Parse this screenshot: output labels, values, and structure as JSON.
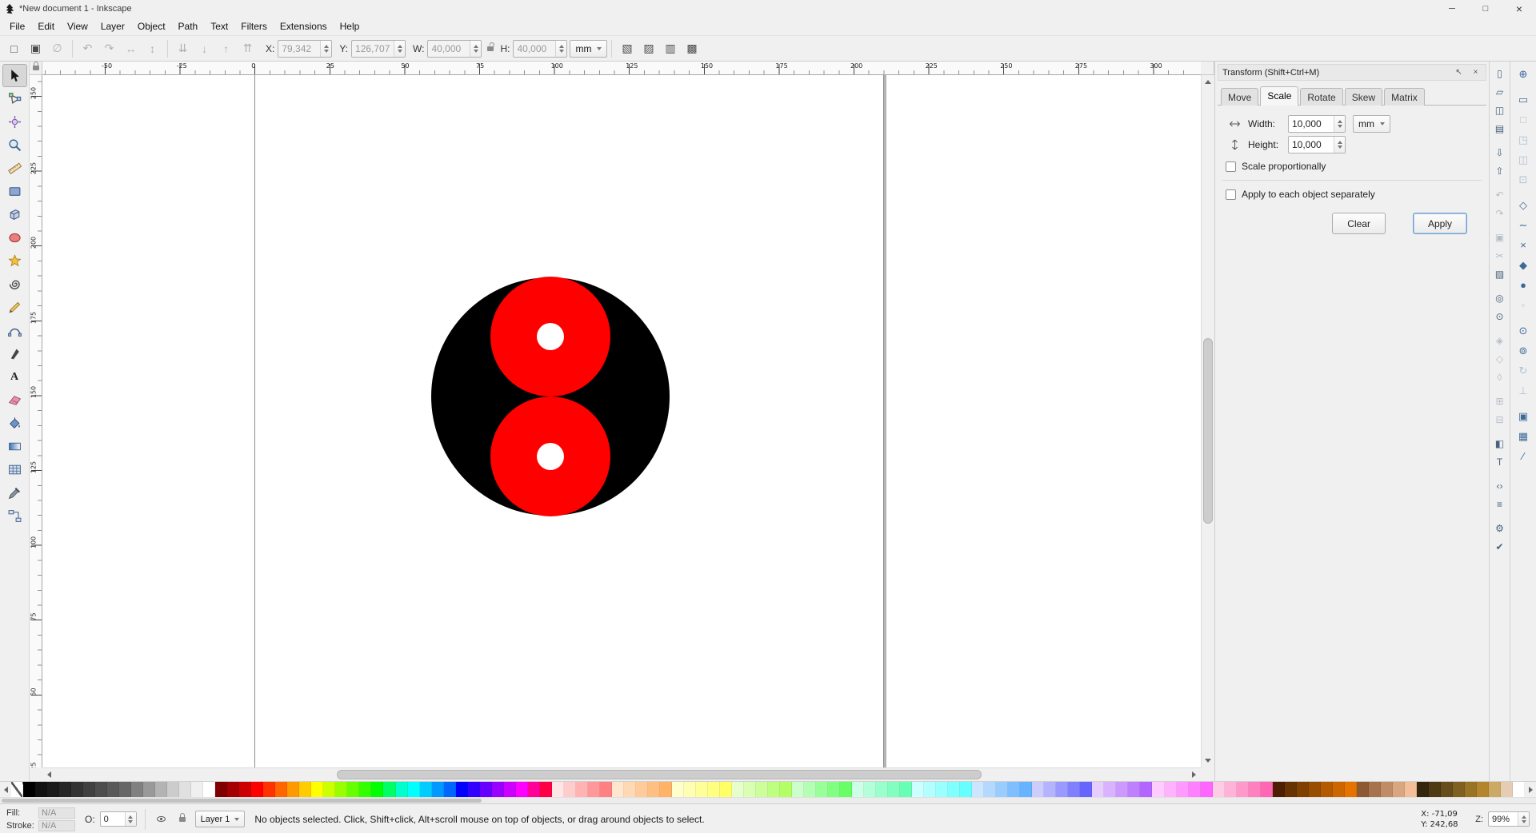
{
  "window": {
    "title": "*New document 1 - Inkscape",
    "minimize_glyph": "─",
    "maximize_glyph": "□",
    "close_glyph": "×"
  },
  "menu": {
    "items": [
      "File",
      "Edit",
      "View",
      "Layer",
      "Object",
      "Path",
      "Text",
      "Filters",
      "Extensions",
      "Help"
    ]
  },
  "toolbar": {
    "groups": [
      [
        {
          "name": "select-all-icon",
          "glyph": "□"
        },
        {
          "name": "select-all-layers-icon",
          "glyph": "▣"
        },
        {
          "name": "deselect-icon",
          "glyph": "∅",
          "disabled": true
        }
      ],
      [
        {
          "name": "rotate-ccw-icon",
          "glyph": "↶",
          "disabled": true
        },
        {
          "name": "rotate-cw-icon",
          "glyph": "↷",
          "disabled": true
        },
        {
          "name": "flip-horizontal-icon",
          "glyph": "↔",
          "disabled": true
        },
        {
          "name": "flip-vertical-icon",
          "glyph": "↕",
          "disabled": true
        }
      ],
      [
        {
          "name": "lower-to-bottom-icon",
          "glyph": "⇊",
          "disabled": true
        },
        {
          "name": "lower-icon",
          "glyph": "↓",
          "disabled": true
        },
        {
          "name": "raise-icon",
          "glyph": "↑",
          "disabled": true
        },
        {
          "name": "raise-to-top-icon",
          "glyph": "⇈",
          "disabled": true
        }
      ]
    ],
    "affect_group": [
      {
        "name": "move-gradients-toggle-icon",
        "glyph": "▧"
      },
      {
        "name": "move-patterns-toggle-icon",
        "glyph": "▨"
      },
      {
        "name": "transform-stroke-toggle-icon",
        "glyph": "▥"
      },
      {
        "name": "preserve-corners-toggle-icon",
        "glyph": "▩"
      }
    ],
    "fields": {
      "x_label": "X:",
      "x": "79,342",
      "y_label": "Y:",
      "y": "126,707",
      "w_label": "W:",
      "w": "40,000",
      "h_label": "H:",
      "h": "40,000",
      "unit": "mm"
    }
  },
  "toolbox": {
    "active_tool": "selector",
    "text_tool_glyph": "A",
    "tools": [
      "selector",
      "node-editor",
      "tweak",
      "zoom",
      "measure",
      "rectangle",
      "box-3d",
      "ellipse",
      "star",
      "spiral",
      "pencil",
      "bezier-pen",
      "calligraphy",
      "text",
      "eraser",
      "paint-bucket",
      "gradient",
      "mesh-gradient",
      "dropper",
      "connector"
    ]
  },
  "rulers": {
    "h_labels": [
      "-50",
      "-25",
      "0",
      "25",
      "50",
      "75",
      "100",
      "125",
      "150",
      "175",
      "200",
      "225",
      "250",
      "275",
      "300"
    ],
    "v_labels": [
      "250",
      "225",
      "200",
      "175",
      "150",
      "125",
      "100",
      "75",
      "50",
      "25"
    ]
  },
  "canvas": {
    "shapes": {
      "outer_fill": "#000000",
      "ring_fill": "#ff0000",
      "ring_stroke": "#c80000",
      "hole_fill": "#ffffff"
    }
  },
  "transform_panel": {
    "title": "Transform (Shift+Ctrl+M)",
    "float_glyph": "↖",
    "close_glyph": "×",
    "tabs": [
      "Move",
      "Scale",
      "Rotate",
      "Skew",
      "Matrix"
    ],
    "active_tab": "Scale",
    "width_label": "Width:",
    "width_value": "10,000",
    "height_label": "Height:",
    "height_value": "10,000",
    "unit": "mm",
    "scale_proportionally_label": "Scale proportionally",
    "apply_separately_label": "Apply to each object separately",
    "clear_label": "Clear",
    "apply_label": "Apply"
  },
  "right_commands": [
    {
      "name": "document-new-icon",
      "glyph": "▯"
    },
    {
      "name": "document-open-icon",
      "glyph": "▱"
    },
    {
      "name": "document-save-icon",
      "glyph": "◫"
    },
    {
      "name": "document-print-icon",
      "glyph": "▤"
    },
    {
      "gap": true
    },
    {
      "name": "import-icon",
      "glyph": "⇩"
    },
    {
      "name": "export-icon",
      "glyph": "⇧"
    },
    {
      "gap": true
    },
    {
      "name": "undo-icon",
      "glyph": "↶",
      "disabled": true
    },
    {
      "name": "redo-icon",
      "glyph": "↷",
      "disabled": true
    },
    {
      "gap": true
    },
    {
      "name": "copy-icon",
      "glyph": "▣",
      "disabled": true
    },
    {
      "name": "cut-icon",
      "glyph": "✂",
      "disabled": true
    },
    {
      "name": "paste-icon",
      "glyph": "▨"
    },
    {
      "gap": true
    },
    {
      "name": "zoom-drawing-icon",
      "glyph": "◎"
    },
    {
      "name": "zoom-page-icon",
      "glyph": "⊙"
    },
    {
      "gap": true
    },
    {
      "name": "duplicate-icon",
      "glyph": "◈",
      "disabled": true
    },
    {
      "name": "clone-icon",
      "glyph": "◇",
      "disabled": true
    },
    {
      "name": "unlink-clone-icon",
      "glyph": "◊",
      "disabled": true
    },
    {
      "gap": true
    },
    {
      "name": "group-icon",
      "glyph": "⊞",
      "disabled": true
    },
    {
      "name": "ungroup-icon",
      "glyph": "⊟",
      "disabled": true
    },
    {
      "gap": true
    },
    {
      "name": "fill-stroke-icon",
      "glyph": "◧"
    },
    {
      "name": "text-dialog-icon",
      "glyph": "T"
    },
    {
      "gap": true
    },
    {
      "name": "xml-editor-icon",
      "glyph": "‹›"
    },
    {
      "name": "align-dialog-icon",
      "glyph": "≡"
    },
    {
      "gap": true
    },
    {
      "name": "document-properties-icon",
      "glyph": "⚙"
    },
    {
      "name": "preferences-icon",
      "glyph": "✔"
    }
  ],
  "snap_controls": [
    {
      "name": "snap-enable-icon",
      "glyph": "⊕"
    },
    {
      "gap": true
    },
    {
      "name": "snap-bbox-icon",
      "glyph": "▭"
    },
    {
      "name": "snap-bbox-edge-icon",
      "glyph": "□",
      "disabled": true
    },
    {
      "name": "snap-bbox-corner-icon",
      "glyph": "◳",
      "disabled": true
    },
    {
      "name": "snap-bbox-midpoint-icon",
      "glyph": "◫",
      "disabled": true
    },
    {
      "name": "snap-bbox-center-icon",
      "glyph": "⊡",
      "disabled": true
    },
    {
      "gap": true
    },
    {
      "name": "snap-nodes-icon",
      "glyph": "◇"
    },
    {
      "name": "snap-path-icon",
      "glyph": "∼"
    },
    {
      "name": "snap-intersection-icon",
      "glyph": "×"
    },
    {
      "name": "snap-cusp-icon",
      "glyph": "◆"
    },
    {
      "name": "snap-smooth-icon",
      "glyph": "●"
    },
    {
      "name": "snap-midpoint-icon",
      "glyph": "◦",
      "disabled": true
    },
    {
      "gap": true
    },
    {
      "name": "snap-others-icon",
      "glyph": "⊙"
    },
    {
      "name": "snap-object-center-icon",
      "glyph": "⊚"
    },
    {
      "name": "snap-rotation-center-icon",
      "glyph": "↻",
      "disabled": true
    },
    {
      "name": "snap-text-baseline-icon",
      "glyph": "⊥",
      "disabled": true
    },
    {
      "gap": true
    },
    {
      "name": "snap-page-border-icon",
      "glyph": "▣"
    },
    {
      "name": "snap-grid-icon",
      "glyph": "▦"
    },
    {
      "name": "snap-guide-icon",
      "glyph": "∕"
    }
  ],
  "palette": {
    "colors": [
      "none",
      "#000000",
      "#111111",
      "#1a1a1a",
      "#262626",
      "#333333",
      "#404040",
      "#4d4d4d",
      "#595959",
      "#666666",
      "#808080",
      "#999999",
      "#b3b3b3",
      "#cccccc",
      "#e0e0e0",
      "#f0f0f0",
      "#ffffff",
      "#800000",
      "#a40000",
      "#cc0000",
      "#ff0000",
      "#ff3300",
      "#ff6600",
      "#ff9900",
      "#ffcc00",
      "#ffff00",
      "#ccff00",
      "#99ff00",
      "#66ff00",
      "#33ff00",
      "#00ff00",
      "#00ff66",
      "#00ffcc",
      "#00ffff",
      "#00ccff",
      "#0099ff",
      "#0066ff",
      "#0000ff",
      "#3300ff",
      "#6600ff",
      "#9900ff",
      "#cc00ff",
      "#ff00ff",
      "#ff0099",
      "#ff0044",
      "#ffe6e6",
      "#ffcccc",
      "#ffb3b3",
      "#ff9999",
      "#ff8080",
      "#ffe6cc",
      "#ffd9b3",
      "#ffcc99",
      "#ffbf80",
      "#ffb366",
      "#ffffcc",
      "#ffffb3",
      "#ffff99",
      "#ffff80",
      "#ffff66",
      "#e6ffcc",
      "#d9ffb3",
      "#ccff99",
      "#bfff80",
      "#b3ff66",
      "#ccffcc",
      "#b3ffb3",
      "#99ff99",
      "#80ff80",
      "#66ff66",
      "#ccffe6",
      "#b3ffd9",
      "#99ffcc",
      "#80ffbf",
      "#66ffb3",
      "#ccffff",
      "#b3ffff",
      "#99ffff",
      "#80ffff",
      "#66ffff",
      "#cce6ff",
      "#b3d9ff",
      "#99ccff",
      "#80bfff",
      "#66b3ff",
      "#ccccff",
      "#b3b3ff",
      "#9999ff",
      "#8080ff",
      "#6666ff",
      "#e6ccff",
      "#d9b3ff",
      "#cc99ff",
      "#bf80ff",
      "#b366ff",
      "#ffccff",
      "#ffb3ff",
      "#ff99ff",
      "#ff80ff",
      "#ff66ff",
      "#ffcce6",
      "#ffb3d9",
      "#ff99cc",
      "#ff80bf",
      "#ff66b3",
      "#4d1f00",
      "#663300",
      "#804000",
      "#994d00",
      "#b35900",
      "#cc6600",
      "#e67300",
      "#8c5933",
      "#a6734d",
      "#bf8c66",
      "#d9a680",
      "#f2bf99",
      "#33260d",
      "#4d3913",
      "#664d1a",
      "#806020",
      "#997326",
      "#b3862d",
      "#ccaa66",
      "#e6ccb3",
      "#ffffff"
    ]
  },
  "statusbar": {
    "fill_label": "Fill:",
    "fill_value": "N/A",
    "stroke_label": "Stroke:",
    "stroke_value": "N/A",
    "opacity_label": "O:",
    "opacity_value": "0",
    "layer_name": "Layer 1",
    "message": "No objects selected. Click, Shift+click, Alt+scroll mouse on top of objects, or drag around objects to select.",
    "x_coord": "X: -71,09",
    "y_coord": "Y: 242,68",
    "zoom_label": "Z:",
    "zoom_value": "99%"
  }
}
